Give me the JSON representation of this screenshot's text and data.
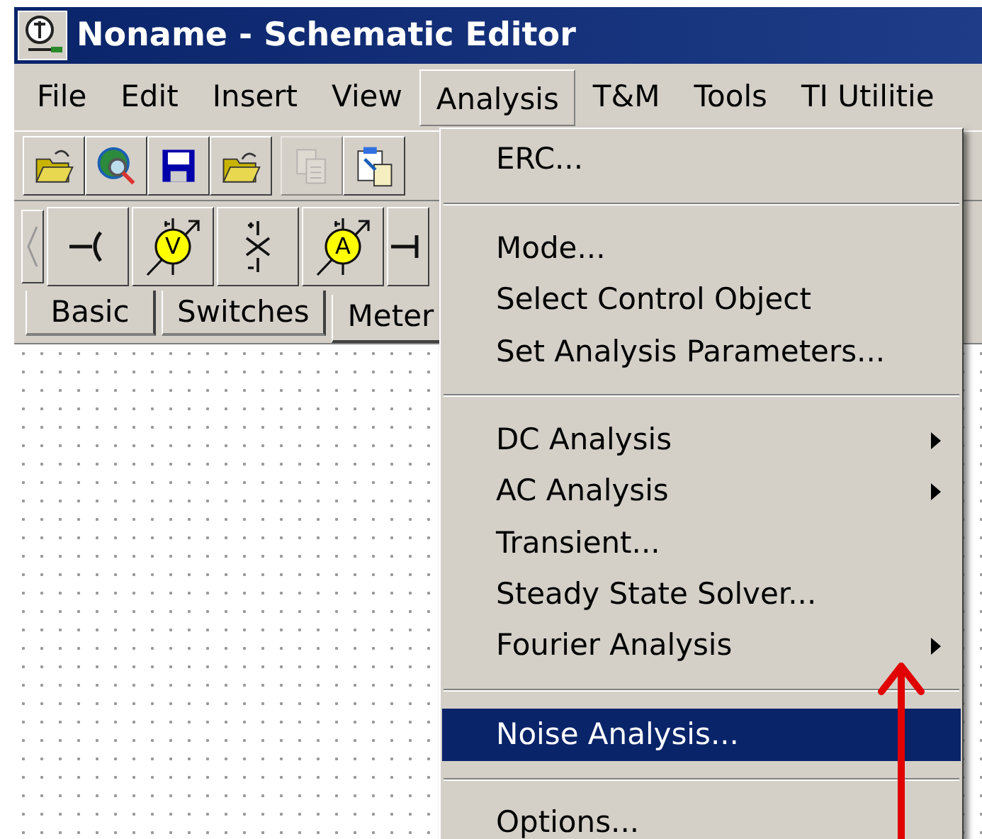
{
  "window": {
    "title": "Noname - Schematic Editor"
  },
  "menu_bar": [
    {
      "label": "File",
      "selected": false
    },
    {
      "label": "Edit",
      "selected": false
    },
    {
      "label": "Insert",
      "selected": false
    },
    {
      "label": "View",
      "selected": false
    },
    {
      "label": "Analysis",
      "selected": true
    },
    {
      "label": "T&M",
      "selected": false
    },
    {
      "label": "Tools",
      "selected": false
    },
    {
      "label": "TI Utilitie",
      "selected": false
    }
  ],
  "toolbar": [
    {
      "kind": "open",
      "disabled": false
    },
    {
      "kind": "globe",
      "disabled": false
    },
    {
      "kind": "save",
      "disabled": false
    },
    {
      "kind": "reopen",
      "disabled": false
    },
    {
      "kind": "copy",
      "disabled": true
    },
    {
      "kind": "paste",
      "disabled": false
    }
  ],
  "components": [
    {
      "kind": "junction"
    },
    {
      "kind": "meter",
      "label": "V"
    },
    {
      "kind": "switch"
    },
    {
      "kind": "meter",
      "label": "A"
    },
    {
      "kind": "wire"
    }
  ],
  "component_tabs": [
    {
      "label": "Basic",
      "selected": false
    },
    {
      "label": "Switches",
      "selected": false
    },
    {
      "label": "Meter",
      "selected": true
    }
  ],
  "analysis_menu": [
    {
      "kind": "item",
      "label": "ERC...",
      "submenu": false,
      "selected": false
    },
    {
      "kind": "separator"
    },
    {
      "kind": "item",
      "label": "Mode...",
      "submenu": false,
      "selected": false
    },
    {
      "kind": "item",
      "label": "Select Control Object",
      "submenu": false,
      "selected": false
    },
    {
      "kind": "item",
      "label": "Set Analysis Parameters...",
      "submenu": false,
      "selected": false
    },
    {
      "kind": "separator"
    },
    {
      "kind": "item",
      "label": "DC Analysis",
      "submenu": true,
      "selected": false
    },
    {
      "kind": "item",
      "label": "AC Analysis",
      "submenu": true,
      "selected": false
    },
    {
      "kind": "item",
      "label": "Transient...",
      "submenu": false,
      "selected": false
    },
    {
      "kind": "item",
      "label": "Steady State Solver...",
      "submenu": false,
      "selected": false
    },
    {
      "kind": "item",
      "label": "Fourier Analysis",
      "submenu": true,
      "selected": false
    },
    {
      "kind": "separator"
    },
    {
      "kind": "item",
      "label": "Noise Analysis...",
      "submenu": false,
      "selected": true
    },
    {
      "kind": "separator"
    },
    {
      "kind": "item",
      "label": "Options...",
      "submenu": false,
      "selected": false
    }
  ]
}
